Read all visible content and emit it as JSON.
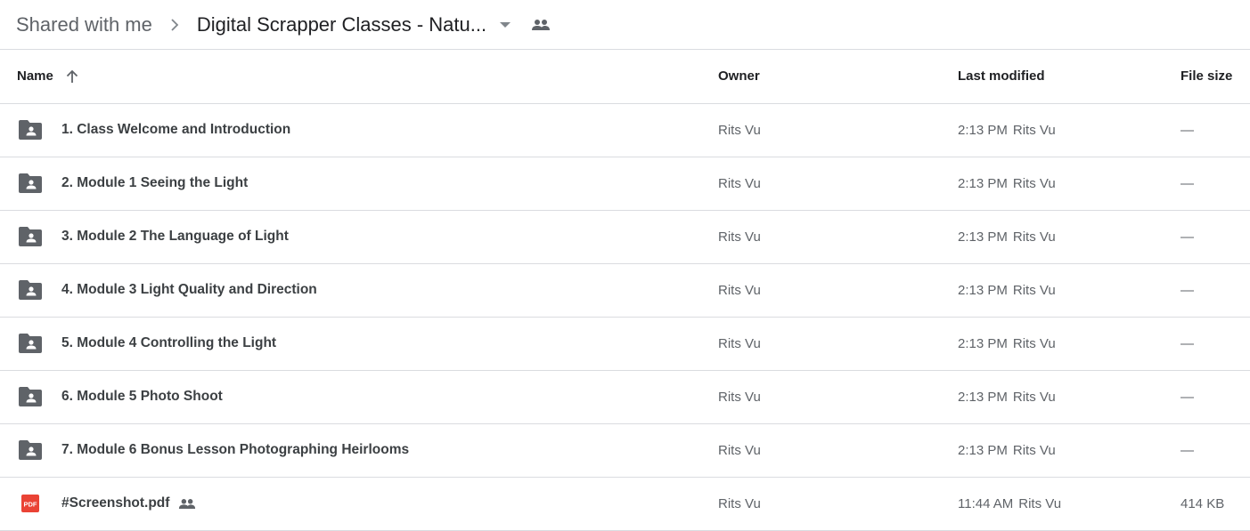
{
  "breadcrumb": {
    "root": "Shared with me",
    "current": "Digital Scrapper Classes - Natu..."
  },
  "columns": {
    "name": "Name",
    "owner": "Owner",
    "last_modified": "Last modified",
    "file_size": "File size"
  },
  "colors": {
    "folder_icon": "#5f6368",
    "pdf_icon": "#ea4335",
    "divider": "#dadce0"
  },
  "rows": [
    {
      "type": "shared-folder",
      "icon": "shared-folder-icon",
      "name": "1. Class Welcome and Introduction",
      "owner": "Rits Vu",
      "modified_time": "2:13 PM",
      "modified_by": "Rits Vu",
      "size": "—"
    },
    {
      "type": "shared-folder",
      "icon": "shared-folder-icon",
      "name": "2. Module 1 Seeing the Light",
      "owner": "Rits Vu",
      "modified_time": "2:13 PM",
      "modified_by": "Rits Vu",
      "size": "—"
    },
    {
      "type": "shared-folder",
      "icon": "shared-folder-icon",
      "name": "3. Module 2 The Language of Light",
      "owner": "Rits Vu",
      "modified_time": "2:13 PM",
      "modified_by": "Rits Vu",
      "size": "—"
    },
    {
      "type": "shared-folder",
      "icon": "shared-folder-icon",
      "name": "4. Module 3 Light Quality and Direction",
      "owner": "Rits Vu",
      "modified_time": "2:13 PM",
      "modified_by": "Rits Vu",
      "size": "—"
    },
    {
      "type": "shared-folder",
      "icon": "shared-folder-icon",
      "name": "5. Module 4 Controlling the Light",
      "owner": "Rits Vu",
      "modified_time": "2:13 PM",
      "modified_by": "Rits Vu",
      "size": "—"
    },
    {
      "type": "shared-folder",
      "icon": "shared-folder-icon",
      "name": "6. Module 5 Photo Shoot",
      "owner": "Rits Vu",
      "modified_time": "2:13 PM",
      "modified_by": "Rits Vu",
      "size": "—"
    },
    {
      "type": "shared-folder",
      "icon": "shared-folder-icon",
      "name": "7. Module 6 Bonus Lesson Photographing Heirlooms",
      "owner": "Rits Vu",
      "modified_time": "2:13 PM",
      "modified_by": "Rits Vu",
      "size": "—"
    },
    {
      "type": "pdf",
      "icon": "pdf-icon",
      "icon_label": "PDF",
      "name": "#Screenshot.pdf",
      "shared": true,
      "owner": "Rits Vu",
      "modified_time": "11:44 AM",
      "modified_by": "Rits Vu",
      "size": "414 KB"
    }
  ]
}
